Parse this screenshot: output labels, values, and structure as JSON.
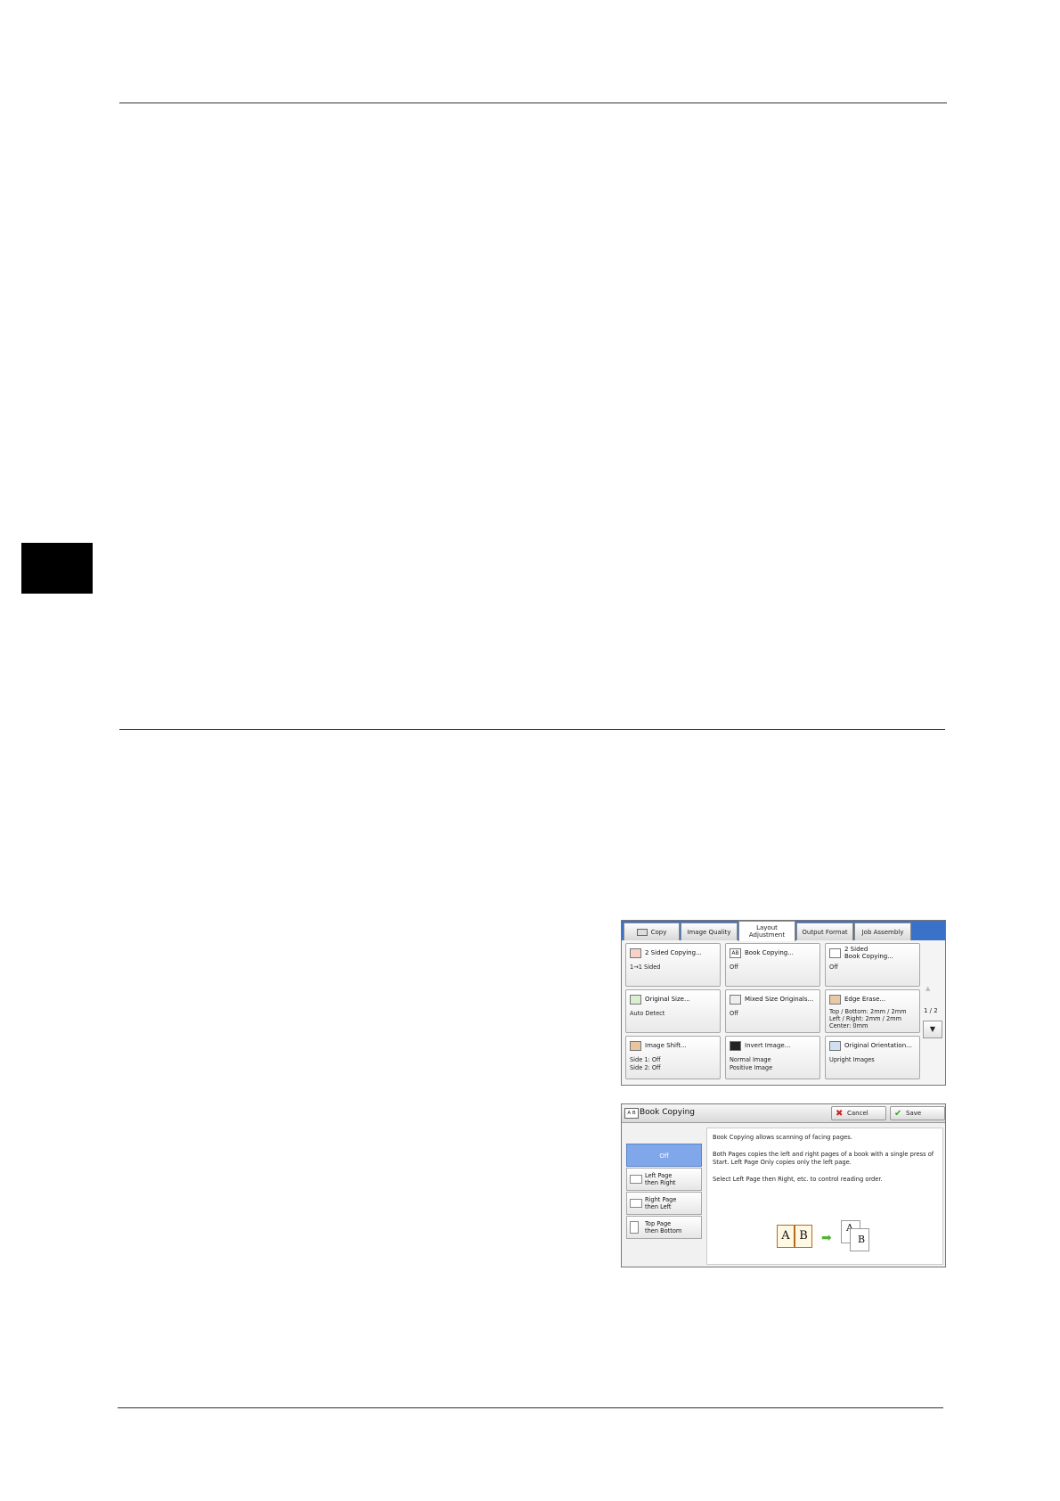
{
  "layout_screen": {
    "tabs": [
      {
        "label": "Copy"
      },
      {
        "label": "Image Quality"
      },
      {
        "label": "Layout\nAdjustment"
      },
      {
        "label": "Output Format"
      },
      {
        "label": "Job Assembly"
      }
    ],
    "features": [
      {
        "label": "2 Sided Copying...",
        "value": "1→1 Sided",
        "icon": "duplex-icon"
      },
      {
        "label": "Book Copying...",
        "value": "Off",
        "icon": "book-copying-icon"
      },
      {
        "label": "2 Sided\nBook Copying...",
        "value": "Off",
        "icon": "two-sided-book-icon"
      },
      {
        "label": "Original Size...",
        "value": "Auto Detect",
        "icon": "original-size-icon"
      },
      {
        "label": "Mixed Size Originals...",
        "value": "Off",
        "icon": "mixed-size-icon"
      },
      {
        "label": "Edge Erase...",
        "value": "Top / Bottom: 2mm / 2mm\nLeft / Right: 2mm / 2mm\nCenter: 0mm",
        "icon": "edge-erase-icon"
      },
      {
        "label": "Image Shift...",
        "value": "Side 1: Off\nSide 2: Off",
        "icon": "image-shift-icon"
      },
      {
        "label": "Invert Image...",
        "value": "Normal Image\nPositive Image",
        "icon": "invert-image-icon"
      },
      {
        "label": "Original Orientation...",
        "value": "Upright Images",
        "icon": "orientation-icon"
      }
    ],
    "page_indicator": "1 / 2",
    "up_arrow": "▲",
    "down_arrow": "▼"
  },
  "book_screen": {
    "title_icon_text": "A B",
    "title": "Book Copying",
    "cancel_label": "Cancel",
    "save_label": "Save",
    "options": [
      {
        "label": "Off"
      },
      {
        "label": "Left Page\nthen Right"
      },
      {
        "label": "Right Page\nthen Left"
      },
      {
        "label": "Top Page\nthen Bottom"
      }
    ],
    "description": [
      "Book Copying allows scanning of facing pages.",
      "Both Pages copies the left and right pages of a book with a single press of Start.  Left Page Only copies only the left page.",
      "Select Left Page then Right, etc. to control reading order."
    ],
    "illustration": {
      "book_left": "A",
      "book_right": "B",
      "sheet_1": "A",
      "sheet_2": "B"
    }
  },
  "colors": {
    "tab_bar": "#3b72c9",
    "selected_option": "#7fa7ea",
    "chapter_tab": "#000000"
  }
}
